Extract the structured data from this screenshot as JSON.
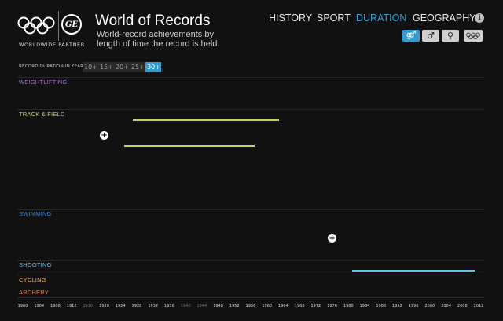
{
  "header": {
    "partner_text": "WORLDWIDE PARTNER",
    "ge_logo_text": "GE",
    "title": "World of Records",
    "subtitle": "World-record achievements by length of time the record is held."
  },
  "nav": {
    "items": [
      {
        "label": "HISTORY",
        "active": false
      },
      {
        "label": "SPORT",
        "active": false
      },
      {
        "label": "DURATION",
        "active": true
      },
      {
        "label": "GEOGRAPHY",
        "active": false
      }
    ],
    "info_icon": "i"
  },
  "gender_filter": {
    "all": "⚤",
    "male": "♂",
    "female": "♀",
    "selected": "all",
    "olympic_rings_icon": "olympic-rings-icon"
  },
  "duration_filter": {
    "label": "RECORD DURATION IN YEARS",
    "options": [
      "10+",
      "15+",
      "20+",
      "25+",
      "30+"
    ],
    "selected": "30+"
  },
  "colors": {
    "accent": "#2f9dd4",
    "weightlifting": "#a07ab8",
    "track_field": "#b8d86a",
    "swimming": "#3f82c2",
    "shooting": "#68c0e8",
    "cycling": "#f2a94a",
    "archery": "#e07f5a"
  },
  "sports": [
    {
      "key": "weightlifting",
      "label": "WEIGHTLIFTING"
    },
    {
      "key": "track_field",
      "label": "TRACK & FIELD"
    },
    {
      "key": "swimming",
      "label": "SWIMMING"
    },
    {
      "key": "shooting",
      "label": "SHOOTING"
    },
    {
      "key": "cycling",
      "label": "CYCLING"
    },
    {
      "key": "archery",
      "label": "ARCHERY"
    }
  ],
  "records": [
    {
      "sport": "track_field",
      "start": 1927,
      "end": 1963
    },
    {
      "sport": "track_field",
      "start": 1925,
      "end": 1957
    },
    {
      "sport": "shooting",
      "start": 1981,
      "end": 2011
    }
  ],
  "expand_markers": [
    {
      "sport": "track_field",
      "year": 1920
    },
    {
      "sport": "swimming",
      "year": 1976
    }
  ],
  "axis": {
    "start_year": 1900,
    "end_year": 2012,
    "ticks": [
      "1900",
      "1904",
      "1908",
      "1912",
      "1916",
      "1920",
      "1924",
      "1928",
      "1932",
      "1936",
      "1940",
      "1944",
      "1948",
      "1952",
      "1956",
      "1960",
      "1964",
      "1968",
      "1972",
      "1976",
      "1980",
      "1984",
      "1988",
      "1992",
      "1996",
      "2000",
      "2004",
      "2008",
      "2012"
    ],
    "dim_ticks": [
      "1916",
      "1940",
      "1944"
    ]
  }
}
